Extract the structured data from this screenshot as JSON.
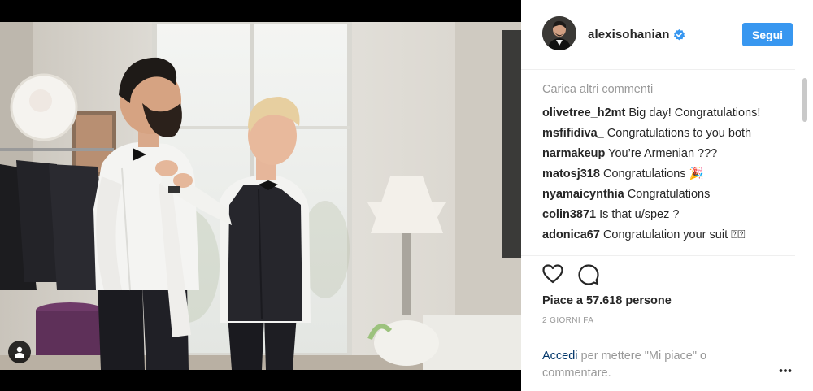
{
  "post": {
    "image_alt": "Photo",
    "username": "alexisohanian",
    "verified": true,
    "follow_label": "Segui",
    "load_more_label": "Carica altri commenti",
    "comments": [
      {
        "user": "olivetree_h2mt",
        "text": "Big day! Congratulations!"
      },
      {
        "user": "msfifidiva_",
        "text": "Congratulations to you both"
      },
      {
        "user": "narmakeup",
        "text": "You’re Armenian ???"
      },
      {
        "user": "matosj318",
        "text": "Congratulations 🎉"
      },
      {
        "user": "nyamaicynthia",
        "text": "Congratulations"
      },
      {
        "user": "colin3871",
        "text": "Is that u/spez ?"
      },
      {
        "user": "adonica67",
        "text": "Congratulation your suit ⍰⍰"
      }
    ],
    "likes_text": "Piace a 57.618 persone",
    "time_text": "2 GIORNI FA",
    "login_prompt": {
      "link_label": "Accedi",
      "rest": " per mettere \"Mi piace\" o commentare."
    }
  },
  "colors": {
    "accent": "#3897f0",
    "link": "#003569",
    "muted": "#999999",
    "text": "#262626"
  },
  "icons": {
    "like": "heart-outline",
    "comment": "speech-bubble-outline",
    "more": "three-dots",
    "verified": "blue-check-badge",
    "tagged_people": "person-silhouette"
  }
}
